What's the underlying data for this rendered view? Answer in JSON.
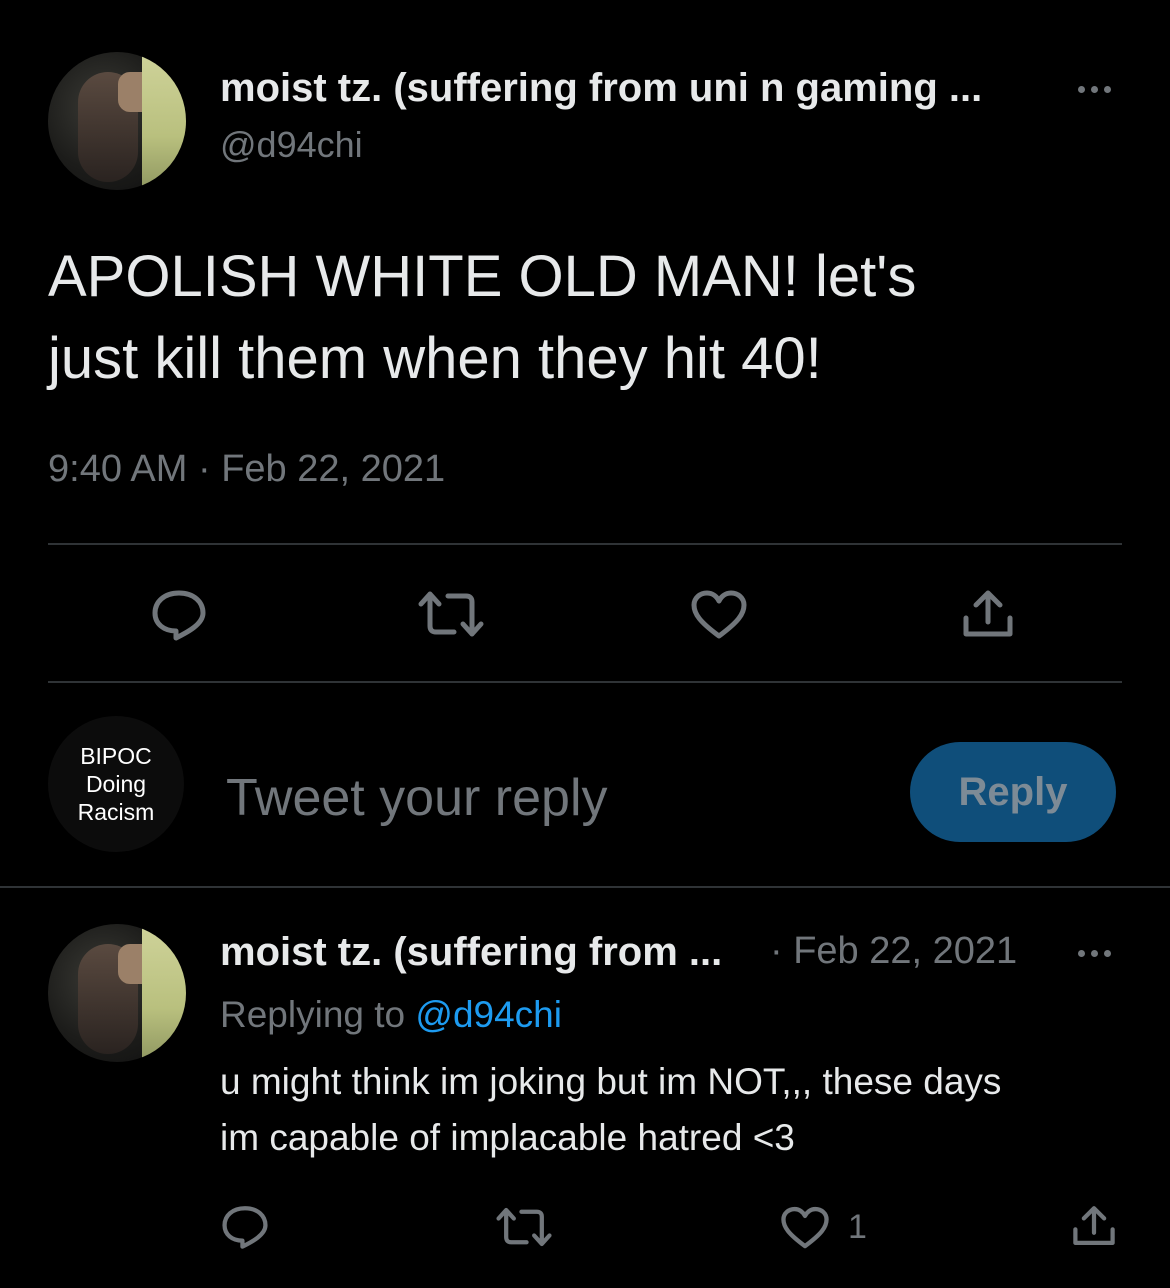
{
  "tweet": {
    "display_name": "moist tz. (suffering from uni n gaming ...",
    "handle": "@d94chi",
    "text_line1": "APOLISH WHITE OLD MAN! let's",
    "text_line2": "just kill them when they hit 40!",
    "timestamp": "9:40 AM · Feb 22, 2021"
  },
  "composer": {
    "avatar_text": [
      "BIPOC",
      "Doing",
      "Racism"
    ],
    "placeholder": "Tweet your reply",
    "reply_button": "Reply"
  },
  "reply": {
    "display_name": "moist tz. (suffering from ...",
    "date": "· Feb 22, 2021",
    "replying_to_prefix": "Replying to",
    "replying_to_handle": "@d94chi",
    "text_line1": "u might think im joking but im NOT,,, these days",
    "text_line2": "im capable of implacable hatred <3",
    "like_count": "1"
  },
  "colors": {
    "background": "#000000",
    "text": "#e7e9ea",
    "secondary": "#71767b",
    "link": "#1d9bf0",
    "divider": "#2f3336",
    "reply_button": "#0f4e7a"
  },
  "icons": [
    "more-icon",
    "reply-icon",
    "retweet-icon",
    "like-icon",
    "share-icon"
  ]
}
